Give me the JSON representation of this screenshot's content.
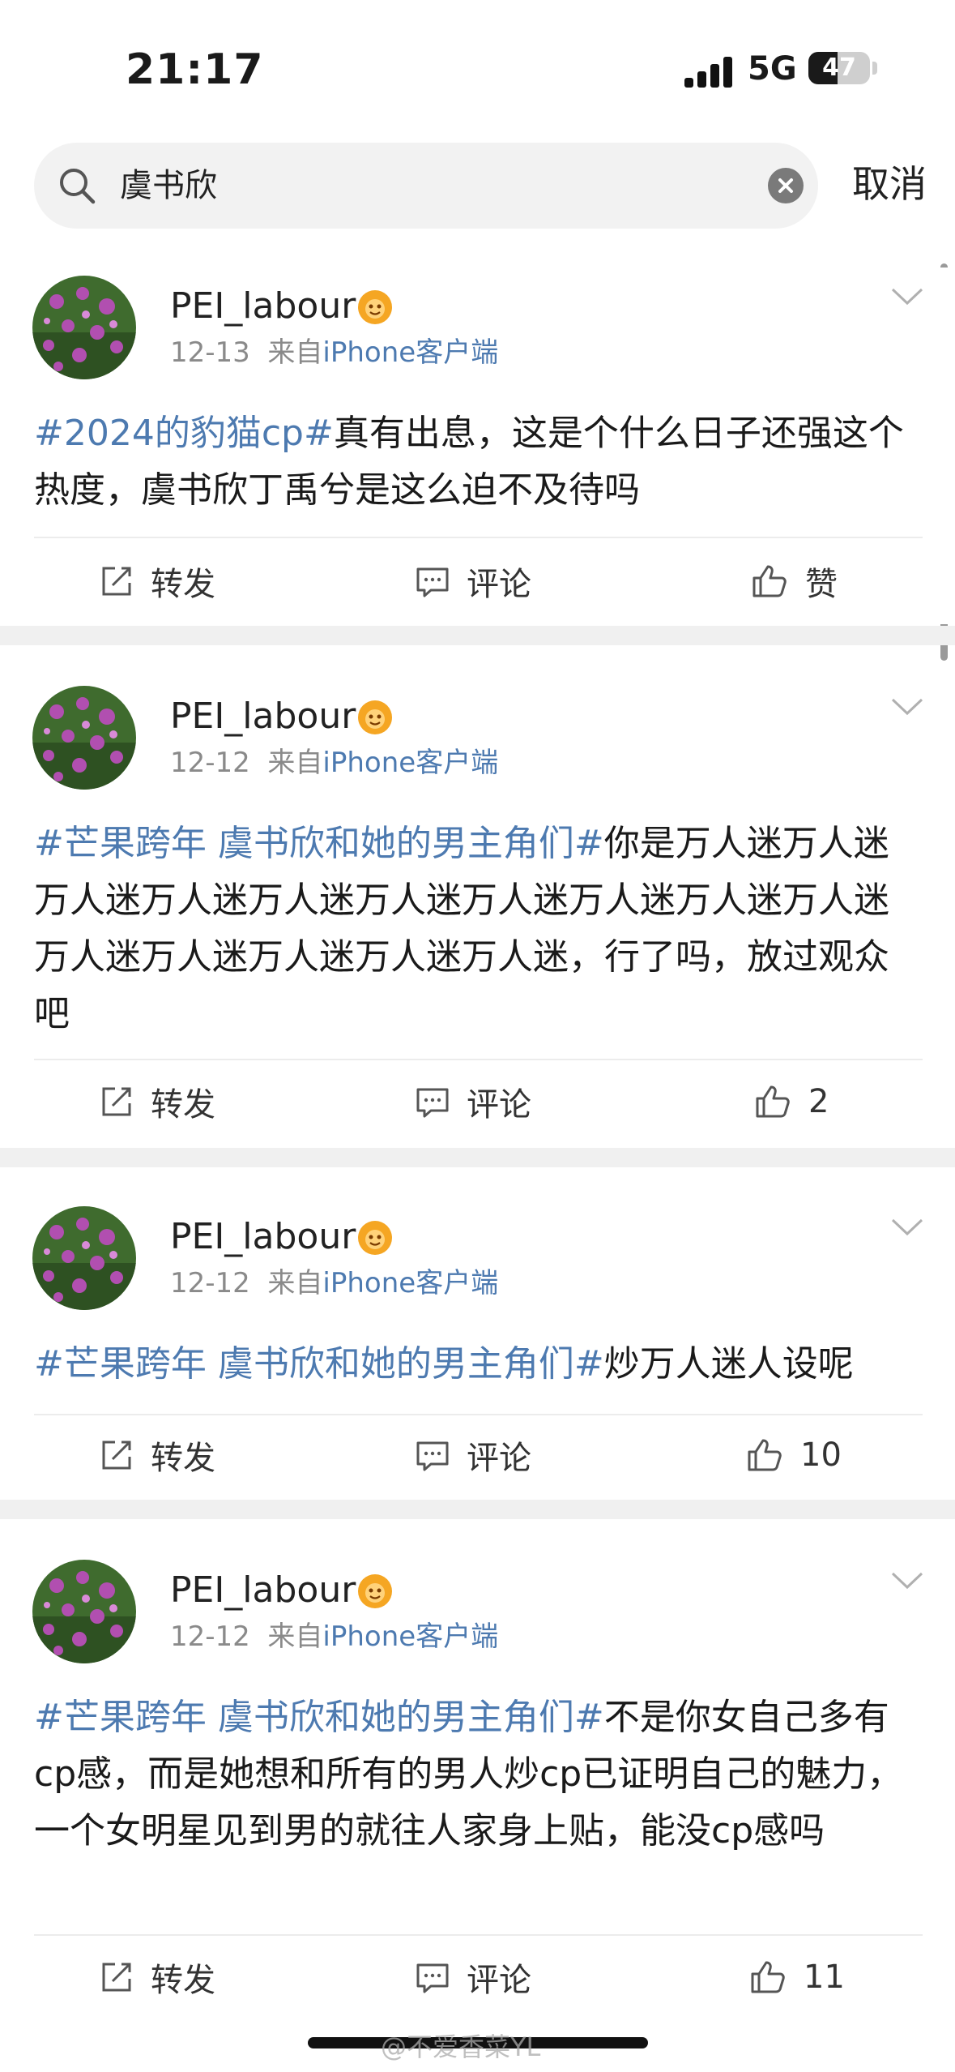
{
  "status": {
    "time": "21:17",
    "network": "5G",
    "battery": "47",
    "battery_level": 0.47
  },
  "search": {
    "query": "虞书欣",
    "cancel_label": "取消"
  },
  "action_labels": {
    "repost": "转发",
    "comment": "评论"
  },
  "posts": [
    {
      "username": "PEI_labour",
      "date": "12-13",
      "via": "来自",
      "source": "iPhone客户端",
      "hashtag": "#2024的豹猫cp#",
      "text": "真有出息，这是个什么日子还强这个热度，虞书欣丁禹兮是这么迫不及待吗",
      "likes": "赞"
    },
    {
      "username": "PEI_labour",
      "date": "12-12",
      "via": "来自",
      "source": "iPhone客户端",
      "hashtag": "#芒果跨年 虞书欣和她的男主角们#",
      "text": "你是万人迷万人迷万人迷万人迷万人迷万人迷万人迷万人迷万人迷万人迷万人迷万人迷万人迷万人迷万人迷，行了吗，放过观众吧",
      "likes": "2"
    },
    {
      "username": "PEI_labour",
      "date": "12-12",
      "via": "来自",
      "source": "iPhone客户端",
      "hashtag": "#芒果跨年 虞书欣和她的男主角们#",
      "text": "炒万人迷人设呢",
      "likes": "10"
    },
    {
      "username": "PEI_labour",
      "date": "12-12",
      "via": "来自",
      "source": "iPhone客户端",
      "hashtag": "#芒果跨年 虞书欣和她的男主角们#",
      "text": "不是你女自己多有cp感，而是她想和所有的男人炒cp已证明自己的魅力，一个女明星见到男的就往人家身上贴，能没cp感吗",
      "likes": "11"
    }
  ],
  "watermark": "@不爱香菜YL",
  "colors": {
    "link_blue": "#4d7ab0",
    "meta_gray": "#8a8a8a",
    "separator": "#f0f0f0",
    "badge_orange": "#f5a623"
  }
}
